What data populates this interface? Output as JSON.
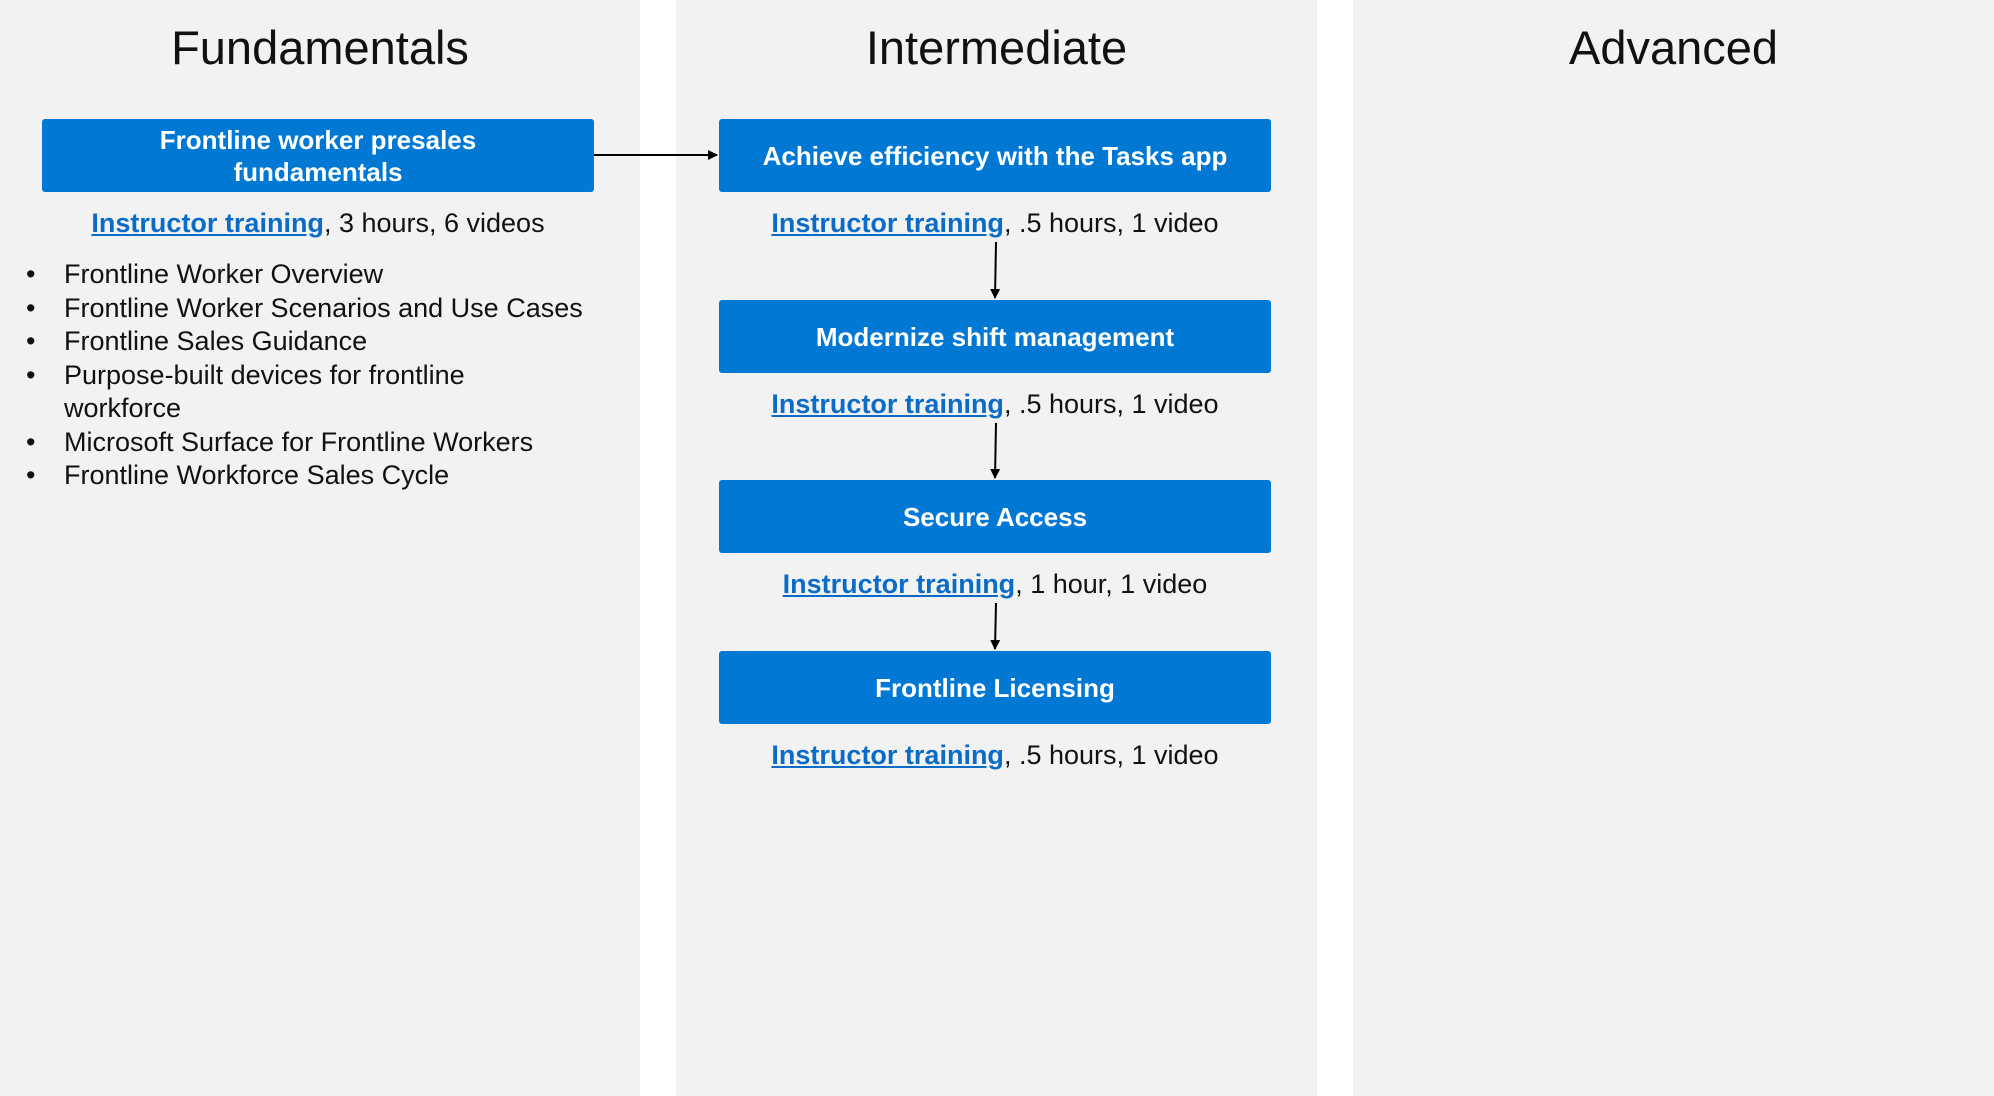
{
  "columns": {
    "fundamentals": "Fundamentals",
    "intermediate": "Intermediate",
    "advanced": "Advanced"
  },
  "fundamentals": {
    "box": {
      "line1": "Frontline worker presales",
      "line2": "fundamentals"
    },
    "link": "Instructor training",
    "details": ", 3 hours, 6 videos",
    "topics": [
      "Frontline Worker Overview",
      "Frontline Worker Scenarios and Use Cases",
      "Frontline Sales Guidance",
      "Purpose-built devices for frontline workforce",
      "Microsoft Surface for Frontline Workers",
      "Frontline Workforce Sales Cycle"
    ],
    "bullet": "•"
  },
  "intermediate": {
    "courses": [
      {
        "title": "Achieve efficiency with the Tasks app",
        "link": "Instructor training",
        "details": ", .5 hours, 1 video"
      },
      {
        "title": "Modernize shift management",
        "link": "Instructor training",
        "details": ", .5 hours, 1 video"
      },
      {
        "title": "Secure Access",
        "link": "Instructor training",
        "details": ", 1 hour, 1 video"
      },
      {
        "title": "Frontline Licensing",
        "link": "Instructor training",
        "details": ", .5 hours, 1 video"
      }
    ]
  },
  "colors": {
    "panel": "#f2f2f2",
    "box": "#0078d4",
    "link": "#0a6cc6"
  }
}
